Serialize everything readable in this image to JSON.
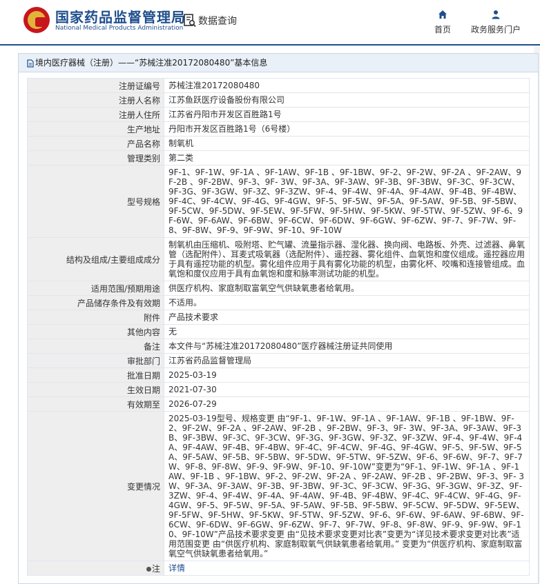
{
  "header": {
    "agency_cn": "国家药品监督管理局",
    "agency_en": "National Medical Products Administration",
    "query_label": "数据查询",
    "nav_home": "首页",
    "nav_portal": "政务服务门户"
  },
  "panel": {
    "title": "境内医疗器械（注册）——“苏械注准20172080480”基本信息"
  },
  "rows": [
    {
      "label": "注册证编号",
      "value": "苏械注准20172080480"
    },
    {
      "label": "注册人名称",
      "value": "江苏鱼跃医疗设备股份有限公司"
    },
    {
      "label": "注册人住所",
      "value": "江苏省丹阳市开发区百胜路1号"
    },
    {
      "label": "生产地址",
      "value": "丹阳市开发区百胜路1号（6号楼）"
    },
    {
      "label": "产品名称",
      "value": "制氧机"
    },
    {
      "label": "管理类别",
      "value": "第二类"
    },
    {
      "label": "型号规格",
      "value": "9F-1、9F-1W、9F-1A 、9F-1AW、9F-1B 、9F-1BW、9F-2、9F-2W、9F-2A 、9F-2AW、9F-2B 、9F-2BW、9F-3、9F- 3W、9F-3A、9F-3AW、9F-3B、9F-3BW、9F-3C、9F-3CW、9F-3G、9F-3GW、9F-3Z、9F-3ZW、9F-4、9F-4W、9F-4A、9F-4AW、9F-4B、9F-4BW、9F-4C、9F-4CW、9F-4G、9F-4GW、9F-5、9F-5W、9F-5A、9F-5AW、9F-5B、9F-5BW、9F-5CW、9F-5DW、9F-5EW、9F-5FW、9F-5HW、9F-5KW、9F-5TW、9F-5ZW、9F-6、9F-6W、9F-6AW、9F-6BW、9F-6CW、9F-6DW、9F-6GW、9F-6ZW、9F-7、9F-7W、9F-8、9F-8W、9F-9、9F-9W、9F-10、9F-10W"
    },
    {
      "label": "结构及组成/主要组成成分",
      "value": "制氧机由压缩机、吸附塔、贮气罐、流量指示器、湿化器、换向阀、电路板、外壳、过滤器、鼻氧管（选配附件）、耳麦式吸氧器（选配附件）、遥控器、雾化组件、血氧饱和度仪组成。遥控器应用于具有遥控功能的机型。雾化组件应用于具有雾化功能的机型，由雾化杯、咬嘴和连接管组成。血氧饱和度仪应用于具有血氧饱和度和脉率测试功能的机型。"
    },
    {
      "label": "适用范围/预期用途",
      "value": "供医疗机构、家庭制取富氧空气供缺氧患者给氧用。"
    },
    {
      "label": "产品储存条件及有效期",
      "value": "不适用。"
    },
    {
      "label": "附件",
      "value": "产品技术要求"
    },
    {
      "label": "其他内容",
      "value": "无"
    },
    {
      "label": "备注",
      "value": "本文件与“苏械注准20172080480”医疗器械注册证共同使用"
    },
    {
      "label": "审批部门",
      "value": "江苏省药品监督管理局"
    },
    {
      "label": "批准日期",
      "value": "2025-03-19"
    },
    {
      "label": "生效日期",
      "value": "2021-07-30"
    },
    {
      "label": "有效期至",
      "value": "2026-07-29"
    },
    {
      "label": "变更情况",
      "value": "2025-03-19型号、规格变更 由“9F-1、9F-1W、9F-1A 、9F-1AW、9F-1B 、9F-1BW、9F-2、9F-2W、9F-2A 、9F-2AW、9F-2B 、9F-2BW、9F-3、9F- 3W、9F-3A、9F-3AW、9F-3B、9F-3BW、9F-3C、9F-3CW、9F-3G、9F-3GW、9F-3Z、9F-3ZW、9F-4、9F-4W、9F-4A、9F-4AW、9F-4B、9F-4BW、9F-4C、9F-4CW、9F-4G、9F-4GW、9F-5、9F-5W、9F-5A、9F-5AW、9F-5B、9F-5BW、9F-5DW、9F-5TW、9F-5ZW、9F-6、9F-6W、9F-7、9F-7W、9F-8、9F-8W、9F-9、9F-9W、9F-10、9F-10W”变更为“9F-1、9F-1W、9F-1A 、9F-1AW、9F-1B 、9F-1BW、9F-2、9F-2W、9F-2A 、9F-2AW、9F-2B 、9F-2BW、9F-3、9F- 3W、9F-3A、9F-3AW、9F-3B、9F-3BW、9F-3C、9F-3CW、9F-3G、9F-3GW、9F-3Z、9F-3ZW、9F-4、9F-4W、9F-4A、9F-4AW、9F-4B、9F-4BW、9F-4C、9F-4CW、9F-4G、9F-4GW、9F-5、9F-5W、9F-5A、9F-5AW、9F-5B、9F-5BW、9F-5CW、9F-5DW、9F-5EW、9F-5FW、9F-5HW、9F-5KW、9F-5TW、9F-5ZW、9F-6、9F-6W、9F-6AW、9F-6BW、9F-6CW、9F-6DW、9F-6GW、9F-6ZW、9F-7、9F-7W、9F-8、9F-8W、9F-9、9F-9W、9F-10、9F-10W”产品技术要求变更 由“见技术要求变更对比表”变更为“详见技术要求变更对比表”适用范围变更 由“供医疗机构、家庭制取氧气供缺氧患者给氧用。” 变更为“供医疗机构、家庭制取富氧空气供缺氧患者给氧用。”"
    }
  ],
  "note": {
    "label": "注",
    "link": "详情"
  }
}
